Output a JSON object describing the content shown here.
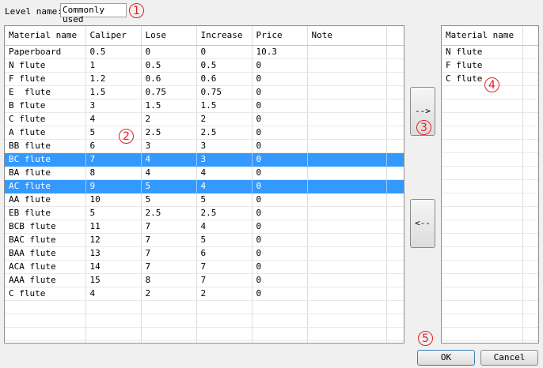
{
  "level": {
    "label": "Level name:",
    "value": "Commonly used"
  },
  "markers": [
    "1",
    "2",
    "3",
    "4",
    "5"
  ],
  "materials_table": {
    "columns": [
      "Material name",
      "Caliper",
      "Lose",
      "Increase",
      "Price",
      "Note"
    ],
    "rows": [
      [
        "Paperboard",
        "0.5",
        "0",
        "0",
        "10.3",
        ""
      ],
      [
        "N flute",
        "1",
        "0.5",
        "0.5",
        "0",
        ""
      ],
      [
        "F flute",
        "1.2",
        "0.6",
        "0.6",
        "0",
        ""
      ],
      [
        "E  flute",
        "1.5",
        "0.75",
        "0.75",
        "0",
        ""
      ],
      [
        "B flute",
        "3",
        "1.5",
        "1.5",
        "0",
        ""
      ],
      [
        "C flute",
        "4",
        "2",
        "2",
        "0",
        ""
      ],
      [
        "A flute",
        "5",
        "2.5",
        "2.5",
        "0",
        ""
      ],
      [
        "BB flute",
        "6",
        "3",
        "3",
        "0",
        ""
      ],
      [
        "BC flute",
        "7",
        "4",
        "3",
        "0",
        ""
      ],
      [
        "BA flute",
        "8",
        "4",
        "4",
        "0",
        ""
      ],
      [
        "AC flute",
        "9",
        "5",
        "4",
        "0",
        ""
      ],
      [
        "AA flute",
        "10",
        "5",
        "5",
        "0",
        ""
      ],
      [
        "EB flute",
        "5",
        "2.5",
        "2.5",
        "0",
        ""
      ],
      [
        "BCB flute",
        "11",
        "7",
        "4",
        "0",
        ""
      ],
      [
        "BAC flute",
        "12",
        "7",
        "5",
        "0",
        ""
      ],
      [
        "BAA flute",
        "13",
        "7",
        "6",
        "0",
        ""
      ],
      [
        "ACA flute",
        "14",
        "7",
        "7",
        "0",
        ""
      ],
      [
        "AAA flute",
        "15",
        "8",
        "7",
        "0",
        ""
      ],
      [
        "C flute",
        "4",
        "2",
        "2",
        "0",
        ""
      ]
    ],
    "selected_rows": [
      8,
      10
    ]
  },
  "selected_table": {
    "columns": [
      "Material name"
    ],
    "rows": [
      [
        "N flute"
      ],
      [
        "F flute"
      ],
      [
        "C flute"
      ]
    ]
  },
  "buttons": {
    "add": "-->",
    "remove": "<--",
    "ok": "OK",
    "cancel": "Cancel"
  },
  "colors": {
    "selection": "#3399ff",
    "marker": "#e02020"
  }
}
